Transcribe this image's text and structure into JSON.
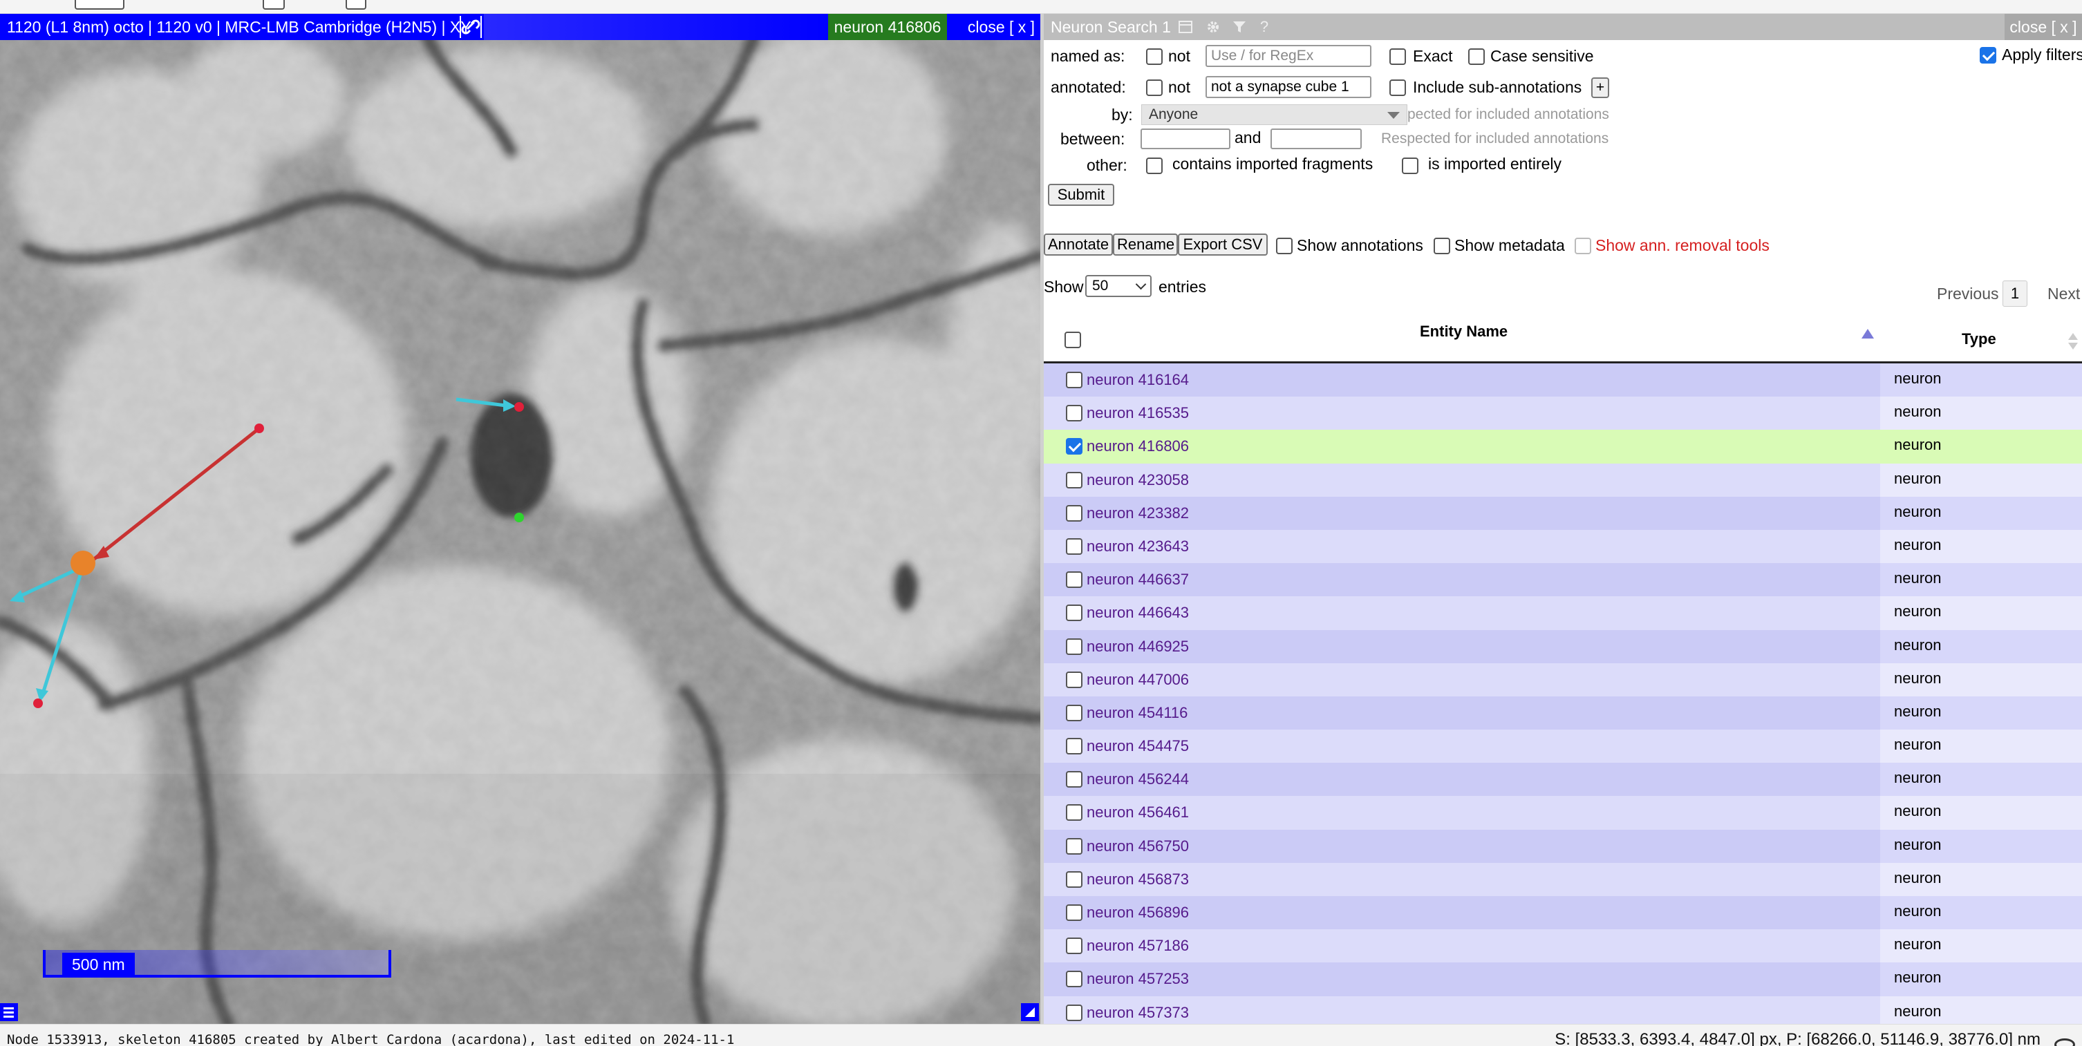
{
  "viewer": {
    "title": "1120 (L1 8nm) octo | 1120 v0 | MRC-LMB Cambridge (H2N5) | XY",
    "active_neuron": "neuron 416806",
    "close_label": "close [ x ]",
    "scale_label": "500 nm",
    "colors": {
      "bar": "#0000ff",
      "active_neuron_bg": "#267b1f",
      "edge_parent": "#c83232",
      "edge_child": "#3fc7d9",
      "active_node": "#e8832a",
      "node_end": "#e0203a",
      "node_leaf": "#2fd42f"
    }
  },
  "panel": {
    "title": "Neuron Search 1",
    "close_label": "close [ x ]",
    "icons": [
      "window-icon",
      "gear-icon",
      "filter-icon",
      "help-icon"
    ],
    "help_glyph": "?",
    "apply_filters": {
      "label": "Apply filters",
      "checked": true
    },
    "named_as": {
      "label": "named as:",
      "not_label": "not",
      "placeholder": "Use / for RegEx",
      "exact_label": "Exact",
      "case_label": "Case sensitive"
    },
    "annotated": {
      "label": "annotated:",
      "not_label": "not",
      "value": "not a synapse cube 1",
      "sub_label": "Include sub-annotations",
      "plus_label": "+"
    },
    "by": {
      "label": "by:",
      "selected": "Anyone",
      "note": "pected for included annotations"
    },
    "between": {
      "label": "between:",
      "and_label": "and",
      "note": "Respected for included annotations"
    },
    "other": {
      "label": "other:",
      "imported_fragments_label": "contains imported fragments",
      "imported_entirely_label": "is imported entirely"
    },
    "submit_label": "Submit",
    "actions": {
      "annotate": "Annotate",
      "rename": "Rename",
      "export_csv": "Export CSV",
      "show_annotations": "Show annotations",
      "show_metadata": "Show metadata",
      "show_removal": "Show ann. removal tools"
    },
    "length": {
      "show_label": "Show",
      "value": "50",
      "entries_label": "entries"
    },
    "pagination": {
      "previous": "Previous",
      "page": "1",
      "next": "Next"
    },
    "table": {
      "headers": {
        "name": "Entity Name",
        "type": "Type"
      },
      "rows": [
        {
          "name": "neuron 416164",
          "type": "neuron",
          "checked": false
        },
        {
          "name": "neuron 416535",
          "type": "neuron",
          "checked": false
        },
        {
          "name": "neuron 416806",
          "type": "neuron",
          "checked": true
        },
        {
          "name": "neuron 423058",
          "type": "neuron",
          "checked": false
        },
        {
          "name": "neuron 423382",
          "type": "neuron",
          "checked": false
        },
        {
          "name": "neuron 423643",
          "type": "neuron",
          "checked": false
        },
        {
          "name": "neuron 446637",
          "type": "neuron",
          "checked": false
        },
        {
          "name": "neuron 446643",
          "type": "neuron",
          "checked": false
        },
        {
          "name": "neuron 446925",
          "type": "neuron",
          "checked": false
        },
        {
          "name": "neuron 447006",
          "type": "neuron",
          "checked": false
        },
        {
          "name": "neuron 454116",
          "type": "neuron",
          "checked": false
        },
        {
          "name": "neuron 454475",
          "type": "neuron",
          "checked": false
        },
        {
          "name": "neuron 456244",
          "type": "neuron",
          "checked": false
        },
        {
          "name": "neuron 456461",
          "type": "neuron",
          "checked": false
        },
        {
          "name": "neuron 456750",
          "type": "neuron",
          "checked": false
        },
        {
          "name": "neuron 456873",
          "type": "neuron",
          "checked": false
        },
        {
          "name": "neuron 456896",
          "type": "neuron",
          "checked": false
        },
        {
          "name": "neuron 457186",
          "type": "neuron",
          "checked": false
        },
        {
          "name": "neuron 457253",
          "type": "neuron",
          "checked": false
        },
        {
          "name": "neuron 457373",
          "type": "neuron",
          "checked": false
        }
      ],
      "colors": {
        "odd": "#d7d7fa",
        "even": "#e9e9fc",
        "odd_sorted": "#cbcbf6",
        "even_sorted": "#dcdcfa",
        "selected": "#d9fbb6"
      }
    }
  },
  "status": {
    "left": "Node 1533913, skeleton 416805 created by Albert Cardona (acardona), last edited on 2024-11-1",
    "right": "S: [8533.3, 6393.4, 4847.0] px, P: [68266.0, 51146.9, 38776.0] nm"
  }
}
